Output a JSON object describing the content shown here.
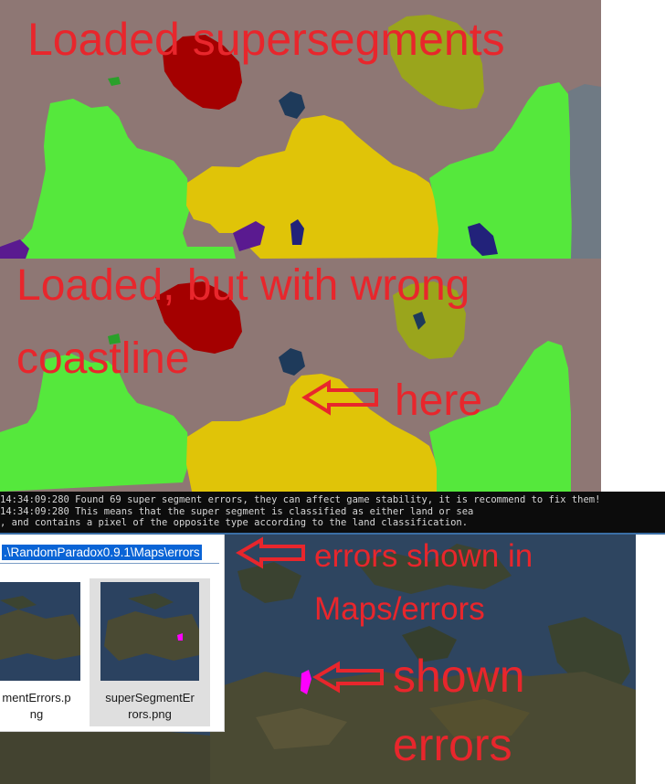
{
  "captions": {
    "loaded": "Loaded supersegments",
    "wrong_line1": "Loaded, but with wrong",
    "wrong_line2": "coastline",
    "here": "here",
    "errors_line1": "errors shown in",
    "errors_line2": "Maps/errors",
    "shown_line1": "shown",
    "shown_line2": "errors"
  },
  "console": {
    "lines": [
      "14:34:09:280 Found 69 super segment errors, they can affect game stability, it is recommend to fix them!",
      "14:34:09:280 This means that the super segment is classified as either land or sea",
      ", and contains a pixel of the opposite type according to the land classification."
    ]
  },
  "explorer": {
    "address": ".\\RandomParadox0.9.1\\Maps\\errors",
    "files": [
      {
        "name_line1": "mentErrors.p",
        "name_line2": "ng"
      },
      {
        "name_line1": "superSegmentEr",
        "name_line2": "rors.png"
      }
    ]
  },
  "colors": {
    "caption": "#e8262c",
    "sea": "#8e7774",
    "land_green": "#55e83c",
    "land_yellow": "#e0c408",
    "land_darkred": "#a40000",
    "land_olive": "#9aa51c",
    "land_gray": "#6f7a84",
    "console_bg": "#0c0c0c",
    "selection": "#0a64d6",
    "error_magenta": "#ff00ff"
  },
  "icons": [
    "arrow-left-icon",
    "file-thumbnail-icon"
  ]
}
